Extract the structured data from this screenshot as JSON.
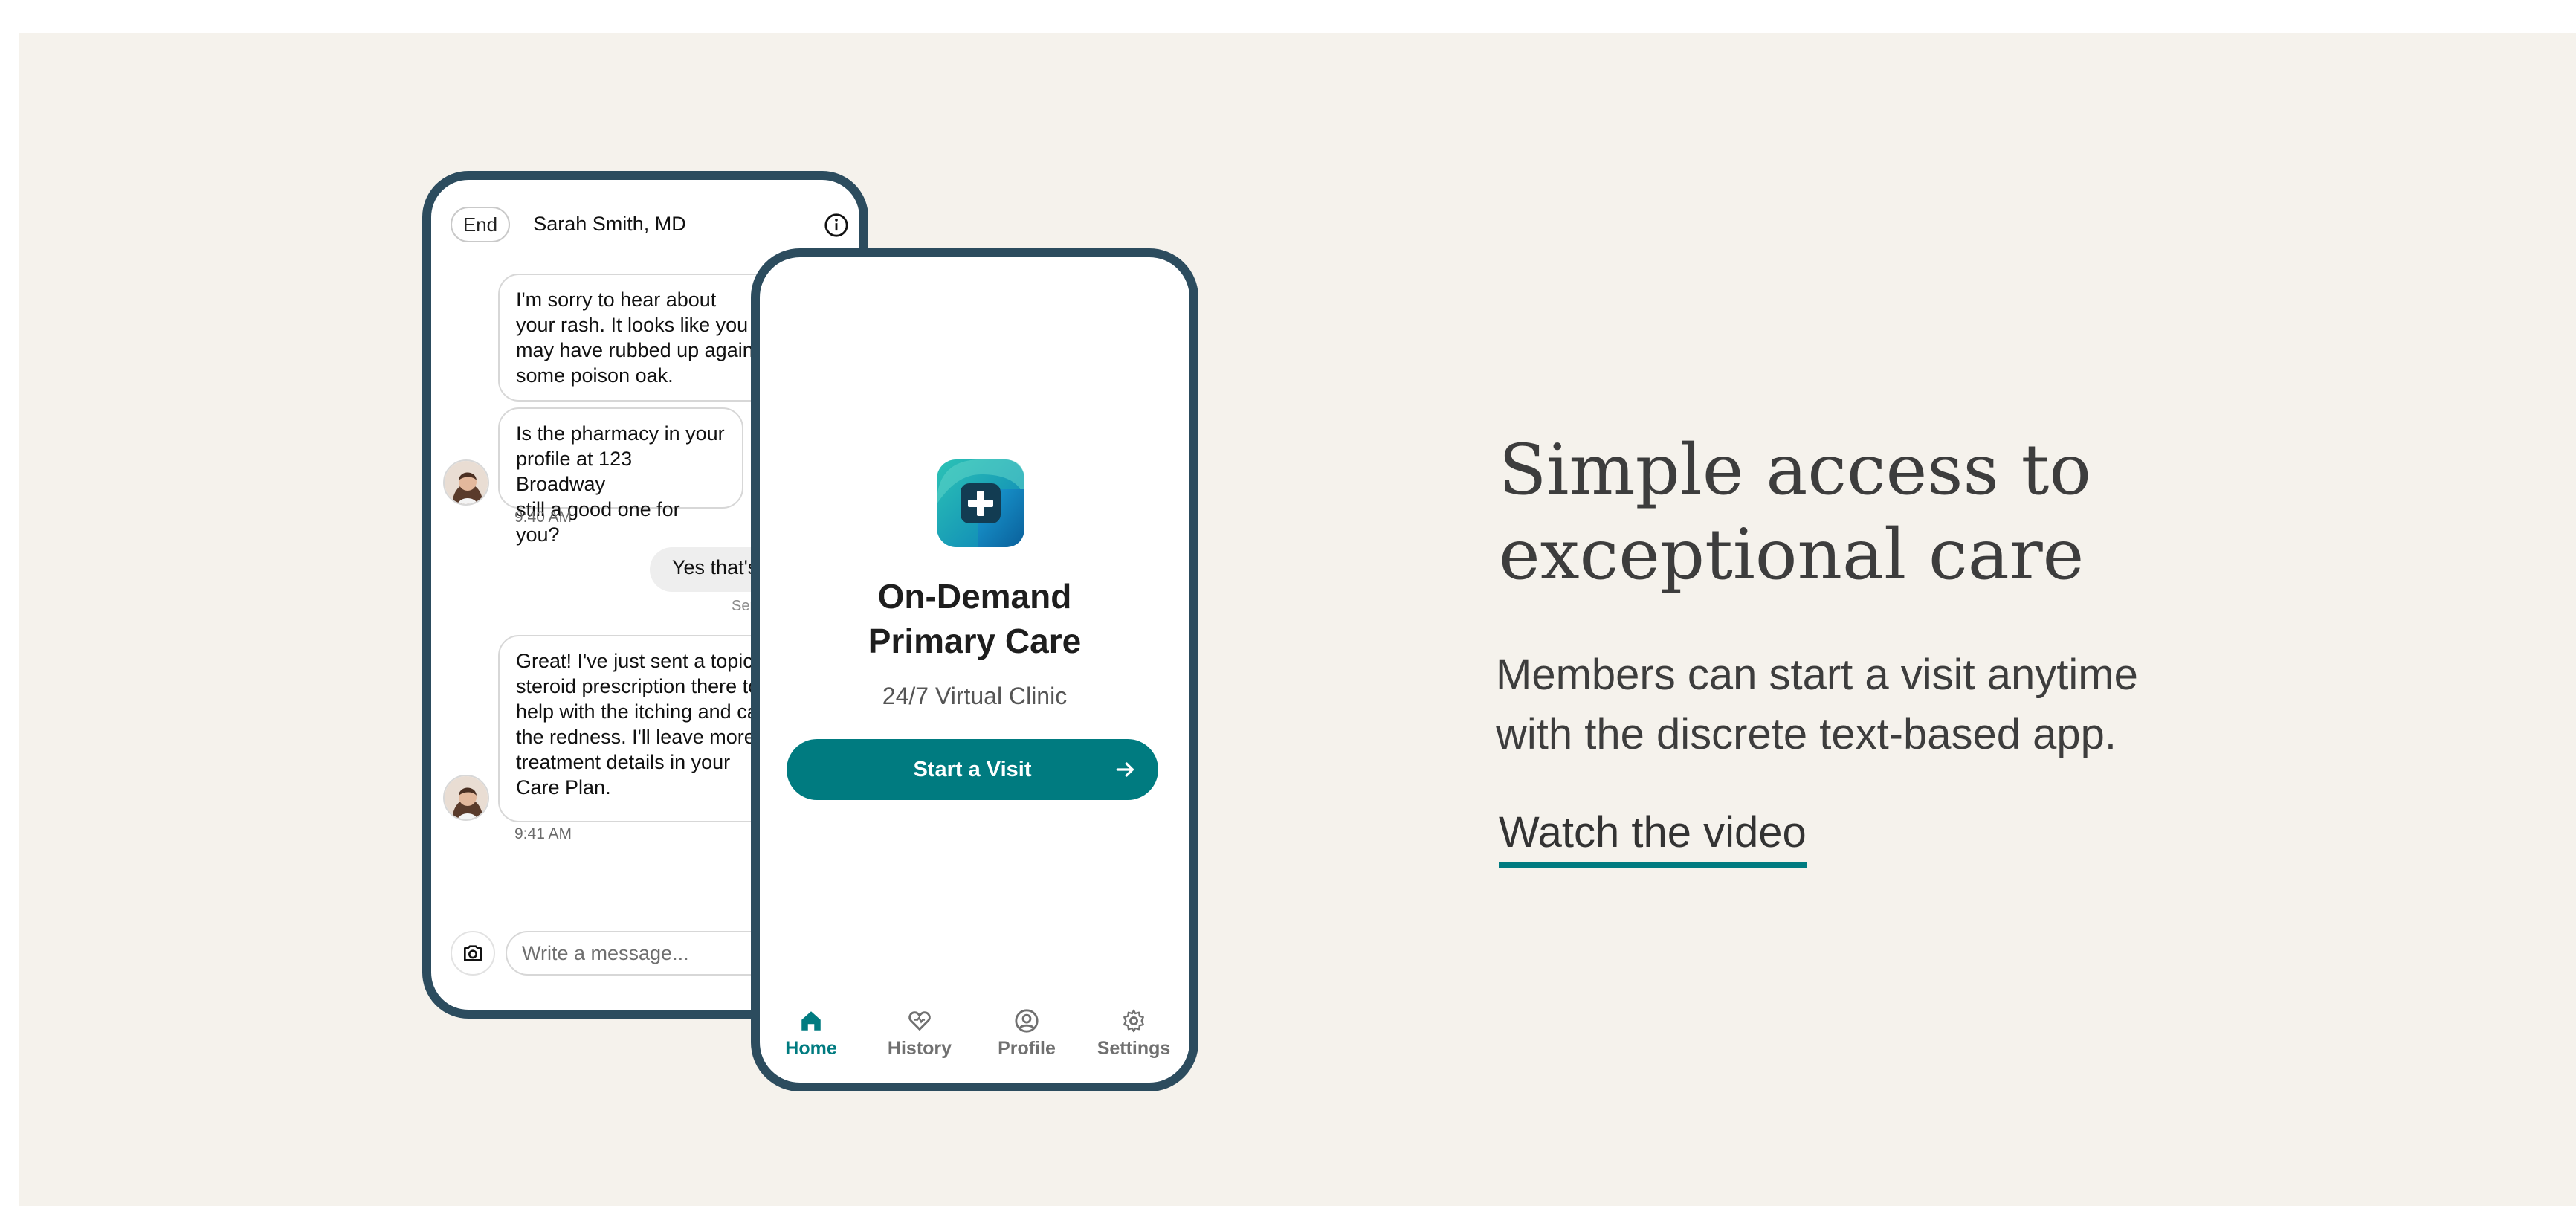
{
  "chat": {
    "end_label": "End",
    "doctor_name": "Sarah Smith, MD",
    "messages": [
      {
        "from": "doctor",
        "text": "I'm sorry to hear about\nyour rash. It looks like you\nmay have rubbed up against\nsome poison oak."
      },
      {
        "from": "doctor",
        "text": "Is the pharmacy in your\nprofile at 123 Broadway\nstill a good one for you?"
      },
      {
        "from": "member",
        "text": "Yes that's right"
      },
      {
        "from": "doctor",
        "text": "Great! I've just sent a topical\nsteroid prescription there to\nhelp with the itching and calm\nthe redness. I'll leave more\ntreatment details in your\nCare Plan."
      }
    ],
    "timestamps": [
      "9:40 AM",
      "9:41 AM"
    ],
    "sent_label": "Sent",
    "input_placeholder": "Write a message..."
  },
  "app": {
    "title": "On-Demand\nPrimary Care",
    "subtitle": "24/7 Virtual Clinic",
    "start_button": "Start a Visit",
    "tabs": [
      {
        "label": "Home",
        "icon": "home-icon",
        "active": true
      },
      {
        "label": "History",
        "icon": "heart-icon",
        "active": false
      },
      {
        "label": "Profile",
        "icon": "user-circle-icon",
        "active": false
      },
      {
        "label": "Settings",
        "icon": "gear-icon",
        "active": false
      }
    ]
  },
  "marketing": {
    "headline": "Simple access to\nexceptional care",
    "body": "Members can start a visit anytime\nwith the discrete text-based app.",
    "link": "Watch the video"
  },
  "colors": {
    "background": "#f5f2ec",
    "phone_frame": "#2c4c5e",
    "accent": "#007b80"
  }
}
